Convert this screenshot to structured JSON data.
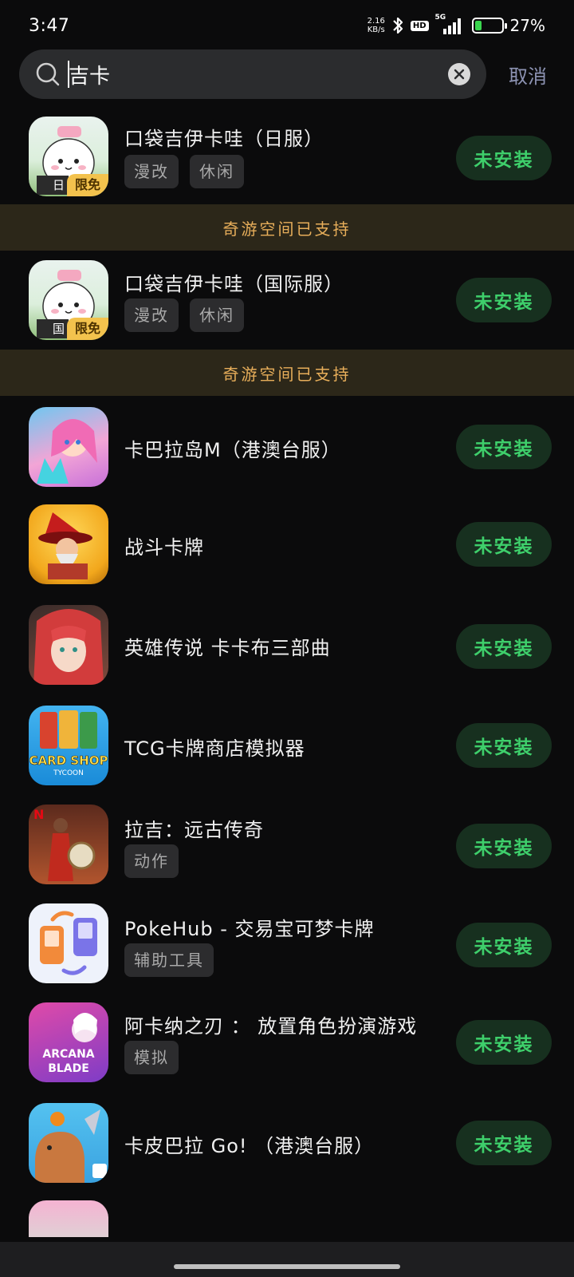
{
  "status_bar": {
    "time": "3:47",
    "net_speed_value": "2.16",
    "net_speed_unit": "KB/s",
    "hd": "HD",
    "signal": "5G",
    "battery_percent": "27%",
    "battery_level": 0.27
  },
  "search": {
    "query": "吉卡",
    "cancel_label": "取消"
  },
  "support_banner_text": "奇游空间已支持",
  "install_label": "未安装",
  "apps": [
    {
      "name": "口袋吉伊卡哇（日服）",
      "tags": [
        "漫改",
        "休闲"
      ],
      "limited_badge": "限免",
      "region_badge": "日"
    },
    {
      "name": "口袋吉伊卡哇（国际服）",
      "tags": [
        "漫改",
        "休闲"
      ],
      "limited_badge": "限免",
      "region_badge": "国"
    },
    {
      "name": "卡巴拉岛M（港澳台服）",
      "tags": []
    },
    {
      "name": "战斗卡牌",
      "tags": []
    },
    {
      "name": "英雄传说 卡卡布三部曲",
      "tags": []
    },
    {
      "name": "TCG卡牌商店模拟器",
      "tags": [],
      "icon_text": "CARD SHOP",
      "icon_subtext": "TYCOON"
    },
    {
      "name": "拉吉：远古传奇",
      "tags": [
        "动作"
      ]
    },
    {
      "name": "PokeHub - 交易宝可梦卡牌",
      "tags": [
        "辅助工具"
      ]
    },
    {
      "name": "阿卡纳之刃 ： 放置角色扮演游戏",
      "tags": [
        "模拟"
      ],
      "icon_text": "ARCANA BLADE"
    },
    {
      "name": "卡皮巴拉 Go! （港澳台服）",
      "tags": []
    }
  ],
  "icons": {
    "search": "search-icon",
    "clear": "close-circle-icon",
    "bluetooth": "bluetooth-icon",
    "signal": "signal-bars-icon",
    "battery": "battery-charging-icon"
  },
  "colors": {
    "background": "#0b0b0c",
    "install_text": "#3ecf6b",
    "install_bg": "#17301f",
    "banner_text": "#e7ae5a",
    "banner_bg": "#2c2719",
    "cancel_text": "#8d93b3"
  }
}
